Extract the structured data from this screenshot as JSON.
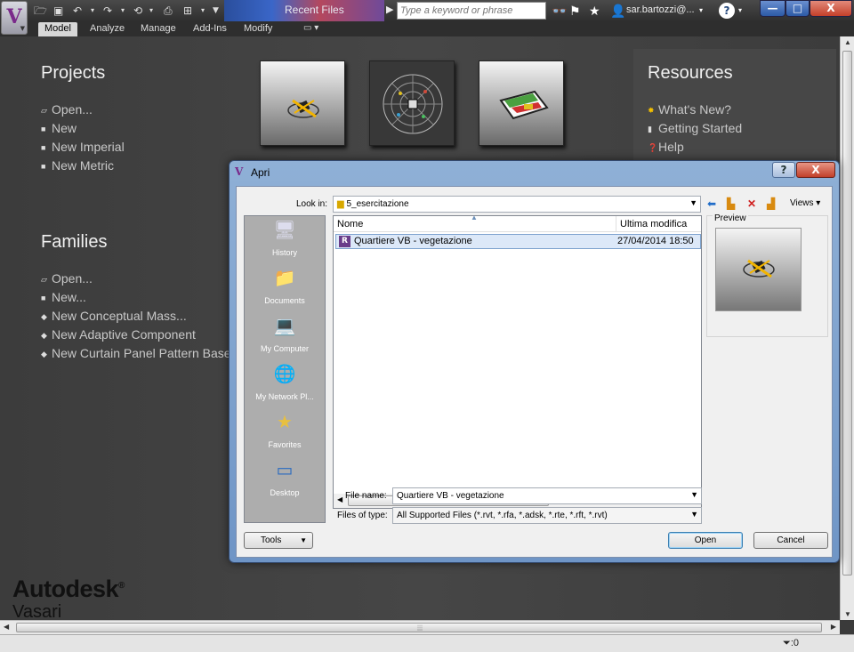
{
  "titlebar": {
    "title": "Recent Files",
    "search_placeholder": "Type a keyword or phrase",
    "user": "sar.bartozzi@...",
    "help": "?",
    "min": "—",
    "max": "□",
    "close": "X"
  },
  "ribbon": {
    "tabs": [
      "Model",
      "Analyze",
      "Manage",
      "Add-Ins",
      "Modify"
    ]
  },
  "projects": {
    "title": "Projects",
    "items": [
      "Open...",
      "New",
      "New Imperial",
      "New Metric"
    ]
  },
  "families": {
    "title": "Families",
    "items": [
      "Open...",
      "New...",
      "New Conceptual Mass...",
      "New Adaptive Component",
      "New Curtain Panel Pattern Based"
    ]
  },
  "resources": {
    "title": "Resources",
    "items": [
      "What's New?",
      "Getting Started",
      "Help"
    ]
  },
  "branding": {
    "logo": "Autodesk",
    "reg": "®",
    "product": "Vasari"
  },
  "status": {
    "filter": ":0"
  },
  "dialog": {
    "title": "Apri",
    "help": "?",
    "close": "X",
    "look_in_label": "Look in:",
    "look_in_value": "5_esercitazione",
    "views_label": "Views",
    "places": [
      "History",
      "Documents",
      "My Computer",
      "My Network Pl...",
      "Favorites",
      "Desktop"
    ],
    "columns": [
      "Nome",
      "Ultima modifica"
    ],
    "files": [
      {
        "name": "Quartiere VB - vegetazione",
        "modified": "27/04/2014 18:50"
      }
    ],
    "preview_label": "Preview",
    "file_name_label": "File name:",
    "file_name_value": "Quartiere VB - vegetazione",
    "files_of_type_label": "Files of type:",
    "files_of_type_value": "All Supported Files  (*.rvt, *.rfa, *.adsk, *.rte, *.rft, *.rvt)",
    "tools_label": "Tools",
    "open_label": "Open",
    "cancel_label": "Cancel"
  }
}
